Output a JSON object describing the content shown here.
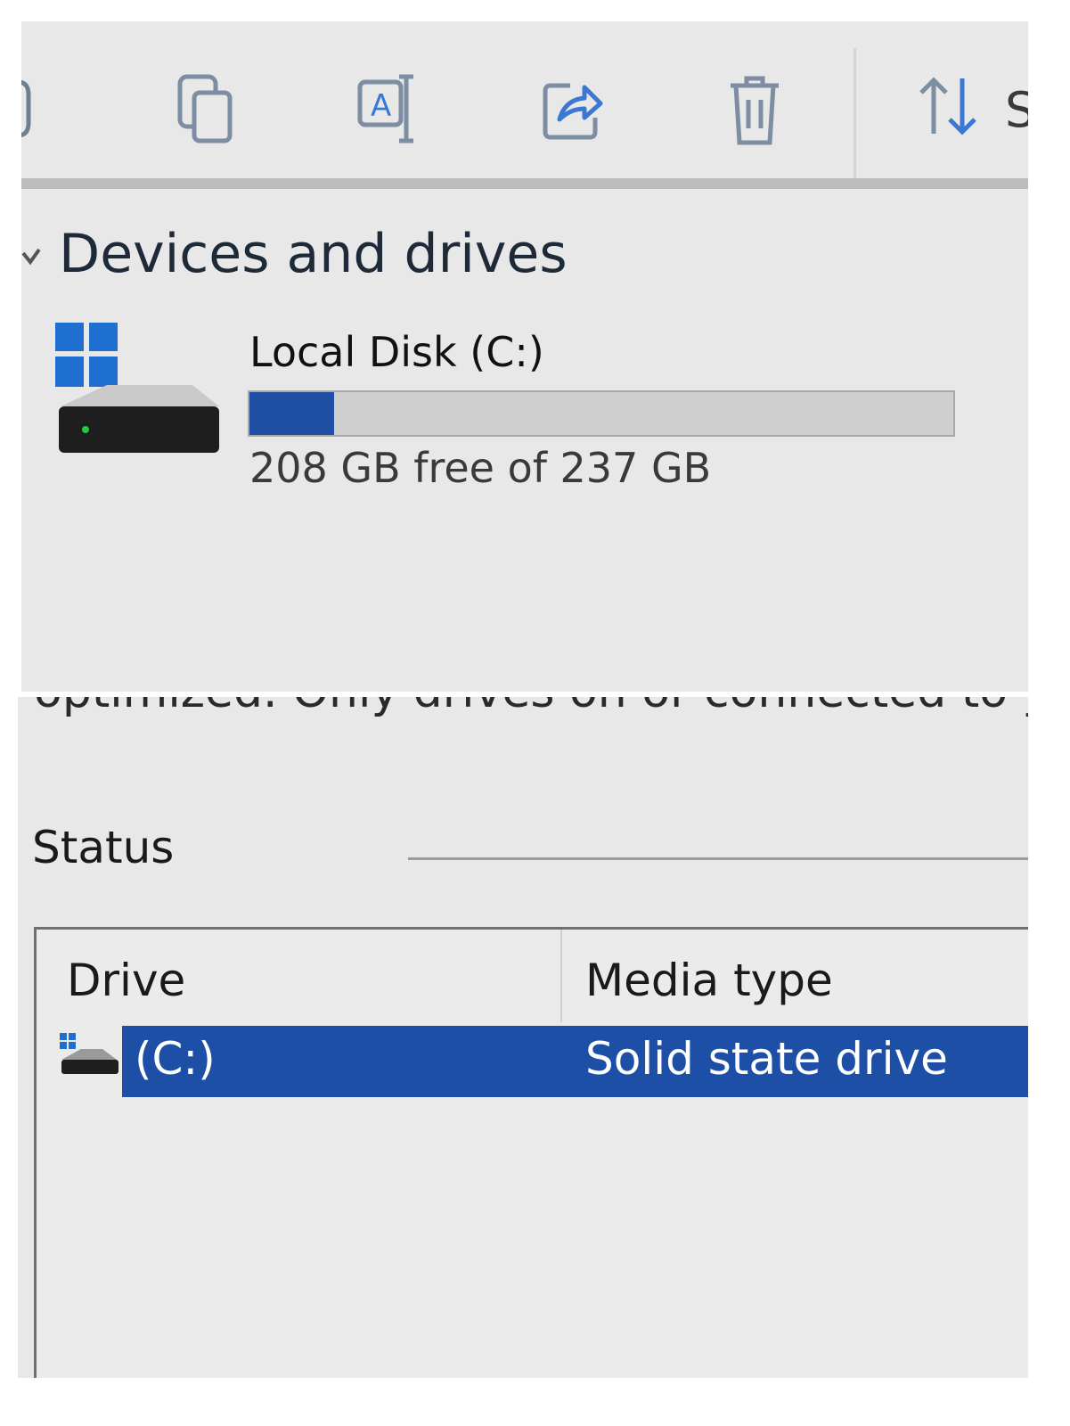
{
  "toolbar": {
    "icons": [
      "copy-icon",
      "rename-icon",
      "share-icon",
      "delete-icon",
      "sort-icon"
    ],
    "sort_label": "S"
  },
  "devices": {
    "title": "Devices and drives",
    "drive": {
      "name": "Local Disk (C:)",
      "free_text": "208 GB free of 237 GB",
      "used_fraction": 0.12
    }
  },
  "optimize": {
    "cut_text": "optimized. Only drives on or connected to your c",
    "status_label": "Status",
    "columns": [
      "Drive",
      "Media type"
    ],
    "rows": [
      {
        "drive": "(C:)",
        "media_type": "Solid state drive",
        "selected": true
      }
    ]
  },
  "colors": {
    "accent": "#1f4fa3",
    "panel_bg": "#e8e8e8",
    "selection": "#1d4fa6"
  }
}
